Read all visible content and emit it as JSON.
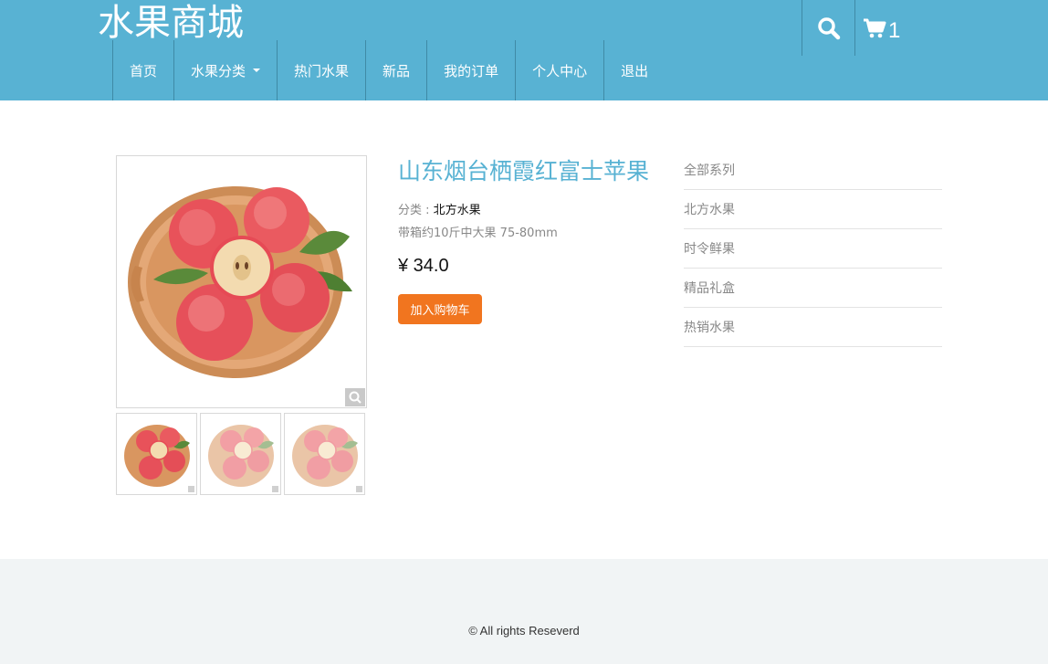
{
  "header": {
    "brand": "水果商城",
    "cart_count": "1",
    "icons": {
      "search": "search-icon",
      "cart": "cart-icon"
    },
    "color": "#58b2d3"
  },
  "nav": {
    "items": [
      {
        "label": "首页"
      },
      {
        "label": "水果分类",
        "dropdown": true
      },
      {
        "label": "热门水果"
      },
      {
        "label": "新品"
      },
      {
        "label": "我的订单"
      },
      {
        "label": "个人中心"
      },
      {
        "label": "退出"
      }
    ]
  },
  "product": {
    "title": "山东烟台栖霞红富士苹果",
    "category_label": "分类 : ",
    "category_value": "北方水果",
    "description": "带箱约10斤中大果 75-80mm",
    "price": "¥ 34.0",
    "add_to_cart": "加入购物车",
    "thumbnails": 3
  },
  "sidebar": {
    "items": [
      "全部系列",
      "北方水果",
      "时令鲜果",
      "精品礼盒",
      "热销水果"
    ]
  },
  "footer": {
    "text": "© All rights Reseverd"
  },
  "colors": {
    "accent": "#58b2d3",
    "button": "#f1751f",
    "footer_bg": "#f1f4f5"
  }
}
